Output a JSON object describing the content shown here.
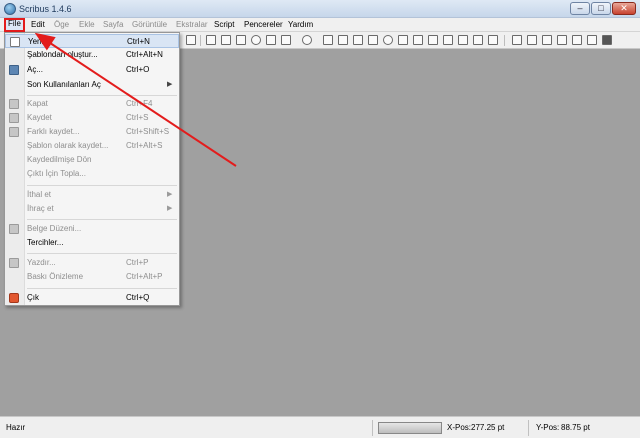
{
  "window": {
    "title": "Scribus 1.4.6",
    "min_label": "–",
    "max_label": "□",
    "close_label": "✕"
  },
  "menubar": {
    "items": [
      "File",
      "Edit",
      "Öge",
      "Ekle",
      "Sayfa",
      "Görüntüle",
      "Ekstralar",
      "Script",
      "Pencereler",
      "Yardım"
    ]
  },
  "file_menu": {
    "items": [
      {
        "label": "Yeni",
        "shortcut": "Ctrl+N",
        "icon": "new-document-icon"
      },
      {
        "label": "Şablondan oluştur...",
        "shortcut": "Ctrl+Alt+N",
        "icon": ""
      },
      {
        "label": "Aç...",
        "shortcut": "Ctrl+O",
        "icon": "open-folder-icon"
      },
      {
        "label": "Son Kullanılanları Aç",
        "shortcut": "",
        "icon": ""
      },
      {
        "label": "Kapat",
        "shortcut": "Ctrl+F4",
        "icon": "close-document-icon"
      },
      {
        "label": "Kaydet",
        "shortcut": "Ctrl+S",
        "icon": "save-icon"
      },
      {
        "label": "Farklı kaydet...",
        "shortcut": "Ctrl+Shift+S",
        "icon": "save-as-icon"
      },
      {
        "label": "Şablon olarak kaydet...",
        "shortcut": "Ctrl+Alt+S",
        "icon": ""
      },
      {
        "label": "Kaydedilmişe Dön",
        "shortcut": "",
        "icon": ""
      },
      {
        "label": "Çıktı İçin Topla...",
        "shortcut": "",
        "icon": ""
      },
      {
        "label": "İthal et",
        "shortcut": "",
        "icon": ""
      },
      {
        "label": "İhraç et",
        "shortcut": "",
        "icon": ""
      },
      {
        "label": "Belge Düzeni...",
        "shortcut": "",
        "icon": "document-setup-icon"
      },
      {
        "label": "Tercihler...",
        "shortcut": "",
        "icon": ""
      },
      {
        "label": "Yazdır...",
        "shortcut": "Ctrl+P",
        "icon": "print-icon"
      },
      {
        "label": "Baskı Önizleme",
        "shortcut": "Ctrl+Alt+P",
        "icon": ""
      },
      {
        "label": "Çık",
        "shortcut": "Ctrl+Q",
        "icon": "quit-icon"
      }
    ]
  },
  "statusbar": {
    "text": "Hazır",
    "xpos_label": "X-Pos:",
    "xpos_value": "277.25 pt",
    "ypos_label": "Y-Pos:",
    "ypos_value": "88.75 pt"
  },
  "annotation": {
    "color": "#e31c1c"
  }
}
